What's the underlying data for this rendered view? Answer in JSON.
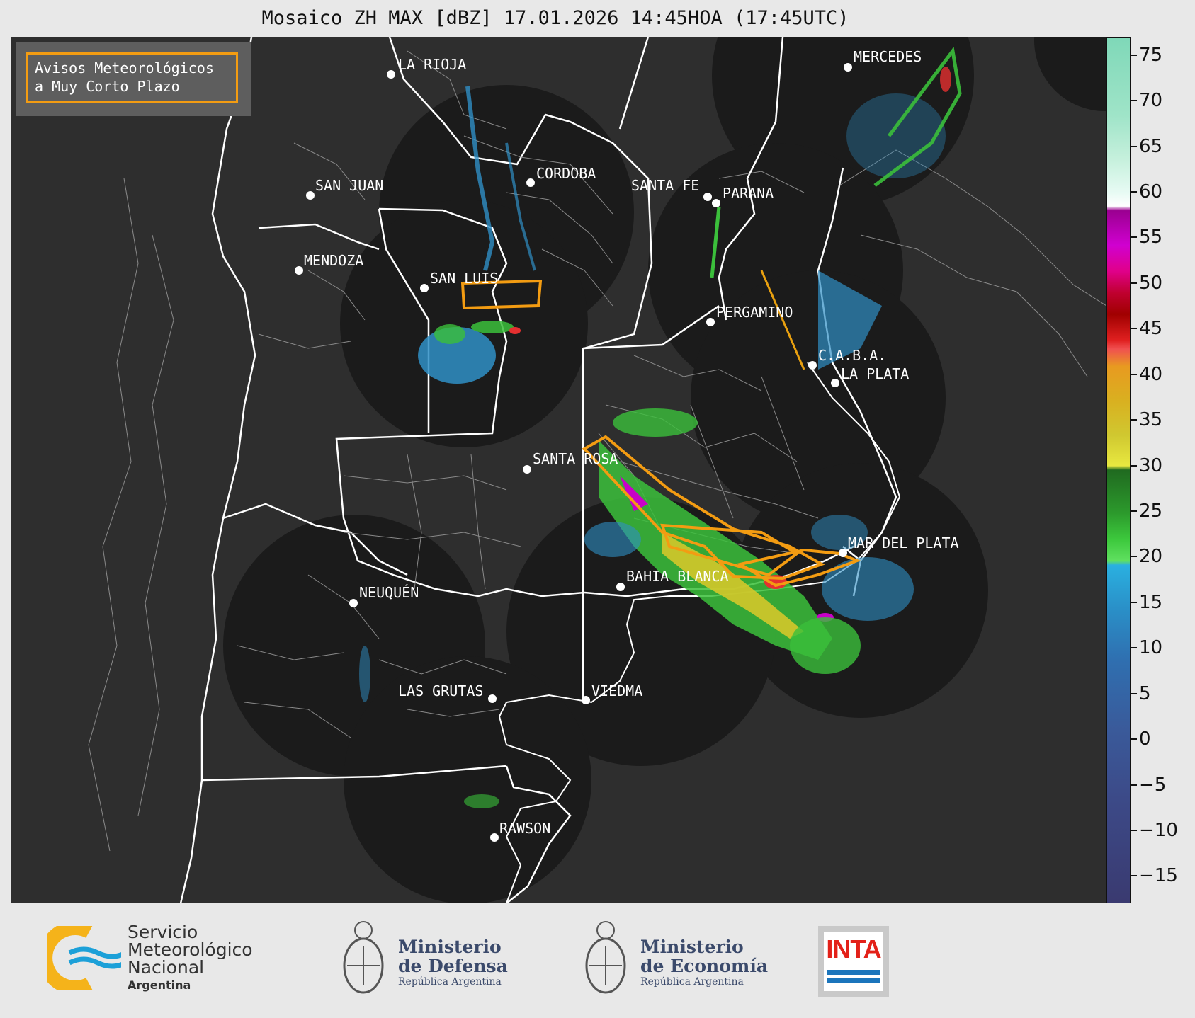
{
  "title": "Mosaico ZH MAX [dBZ] 17.01.2026 14:45HOA (17:45UTC)",
  "legend": {
    "line1": "Avisos Meteorológicos",
    "line2": "a Muy Corto Plazo",
    "border_color": "#f39c12"
  },
  "colorbar": {
    "unit": "dBZ",
    "ticks": [
      "75",
      "70",
      "65",
      "60",
      "55",
      "50",
      "45",
      "40",
      "35",
      "30",
      "25",
      "20",
      "15",
      "10",
      "5",
      "0",
      "−5",
      "−10",
      "−15"
    ]
  },
  "cities": [
    {
      "name": "LA RIOJA"
    },
    {
      "name": "CORDOBA"
    },
    {
      "name": "SAN JUAN"
    },
    {
      "name": "SANTA FE"
    },
    {
      "name": "PARANA"
    },
    {
      "name": "MENDOZA"
    },
    {
      "name": "SAN LUIS"
    },
    {
      "name": "PERGAMINO"
    },
    {
      "name": "C.A.B.A."
    },
    {
      "name": "LA PLATA"
    },
    {
      "name": "MERCEDES"
    },
    {
      "name": "SANTA ROSA"
    },
    {
      "name": "MAR DEL PLATA"
    },
    {
      "name": "BAHIA BLANCA"
    },
    {
      "name": "NEUQUÉN"
    },
    {
      "name": "LAS GRUTAS"
    },
    {
      "name": "VIEDMA"
    },
    {
      "name": "RAWSON"
    }
  ],
  "footer": {
    "smn": {
      "line1": "Servicio",
      "line2": "Meteorológico",
      "line3": "Nacional",
      "line4": "Argentina"
    },
    "defensa": {
      "line1": "Ministerio",
      "line2": "de Defensa",
      "line3": "República Argentina"
    },
    "economia": {
      "line1": "Ministerio",
      "line2": "de Economía",
      "line3": "República Argentina"
    },
    "inta": {
      "text": "INTA"
    }
  }
}
